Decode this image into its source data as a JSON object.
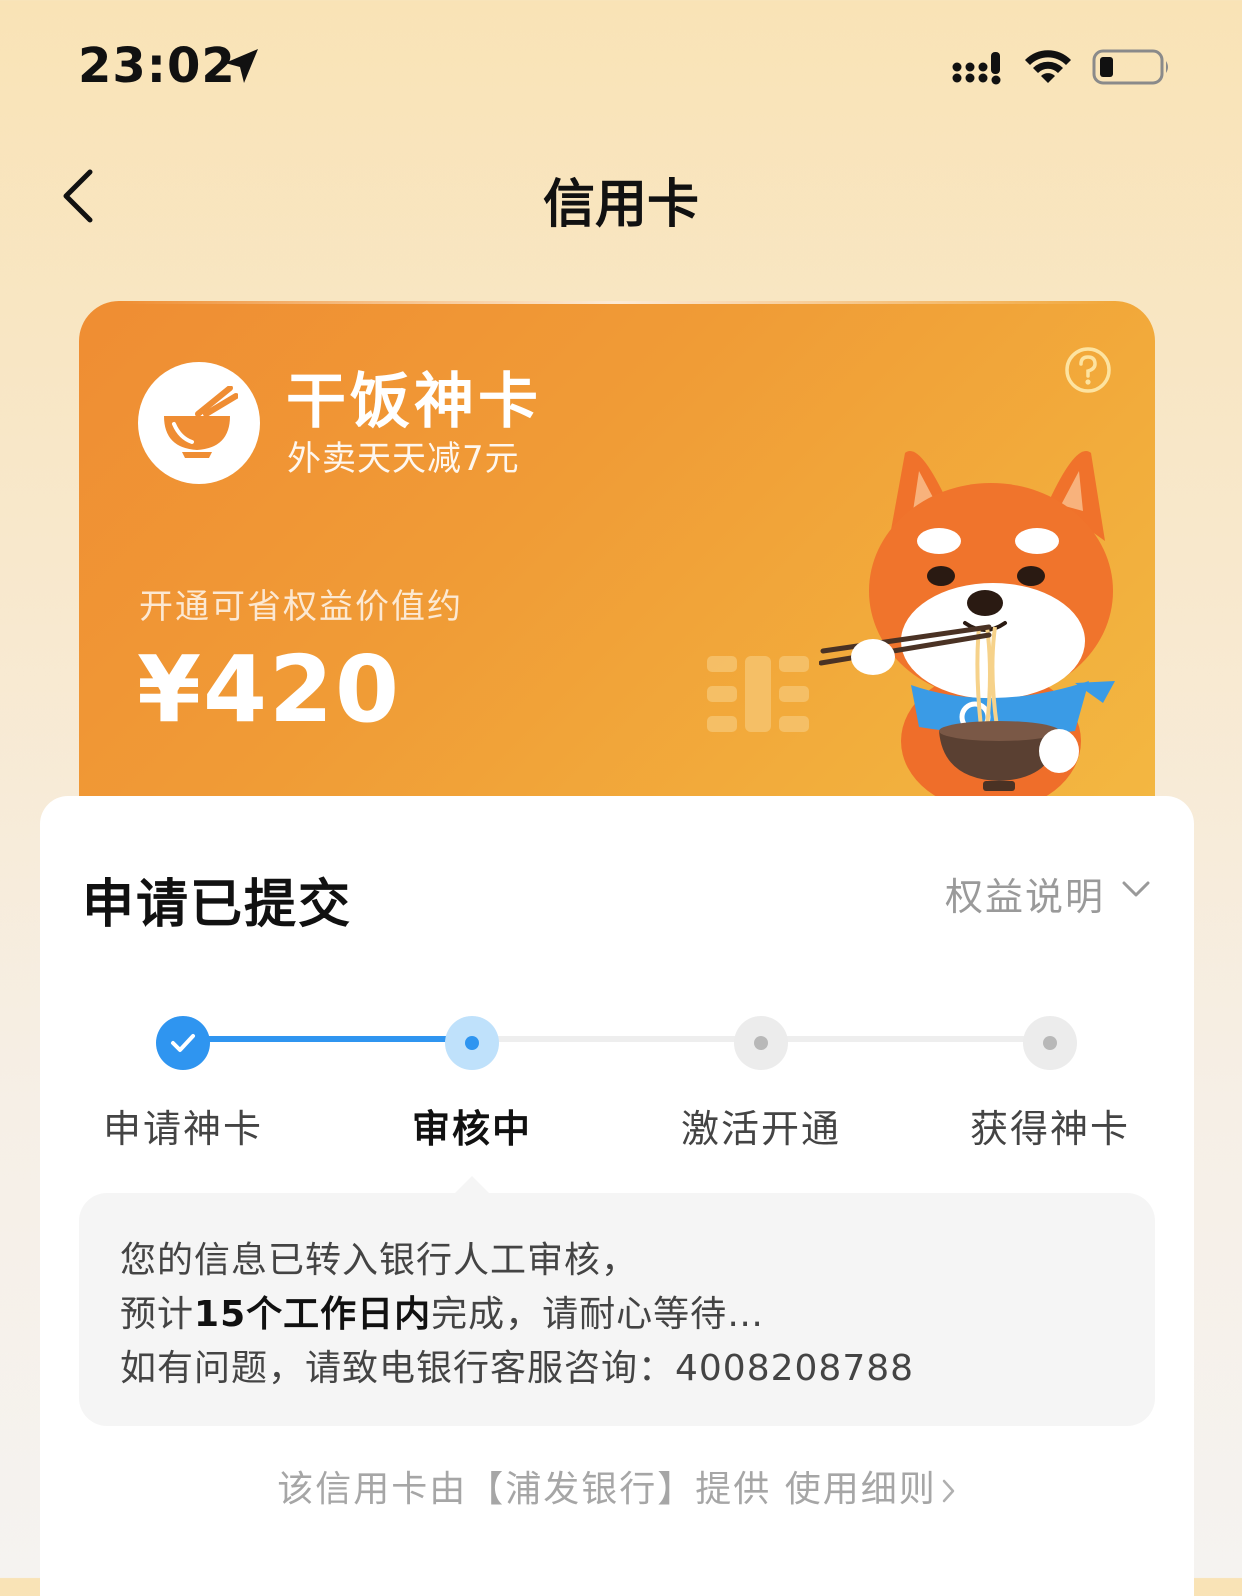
{
  "status_bar": {
    "time": "23:02",
    "icons": [
      "location-arrow-icon",
      "signal-icon",
      "wifi-icon",
      "battery-icon"
    ]
  },
  "nav": {
    "back_icon": "chevron-left-icon",
    "title": "信用卡"
  },
  "card": {
    "name": "干饭神卡",
    "slogan": "外卖天天减7元",
    "value_label": "开通可省权益价值约",
    "value_amount": "¥420",
    "logo_icon": "bowl-chopsticks-icon",
    "help_icon": "question-circle-icon",
    "mascot": "shiba-dog-mascot",
    "colors": {
      "gradient_start": "#ef8d33",
      "gradient_end": "#f3b842"
    }
  },
  "panel": {
    "title": "申请已提交",
    "benefits_link": "权益说明",
    "steps": [
      {
        "label": "申请神卡",
        "state": "done"
      },
      {
        "label": "审核中",
        "state": "current"
      },
      {
        "label": "激活开通",
        "state": "pending"
      },
      {
        "label": "获得神卡",
        "state": "pending"
      }
    ],
    "progress_fraction": 0.333,
    "accent_color": "#2f95f0",
    "info": {
      "line1": "您的信息已转入银行人工审核，",
      "line2_prefix": "预计",
      "line2_bold": "15个工作日内",
      "line2_suffix": "完成，请耐心等待…",
      "line3": "如有问题，请致电银行客服咨询：4008208788"
    },
    "footer": {
      "provider_text": "该信用卡由【浦发银行】提供",
      "rules_link": "使用细则"
    }
  }
}
